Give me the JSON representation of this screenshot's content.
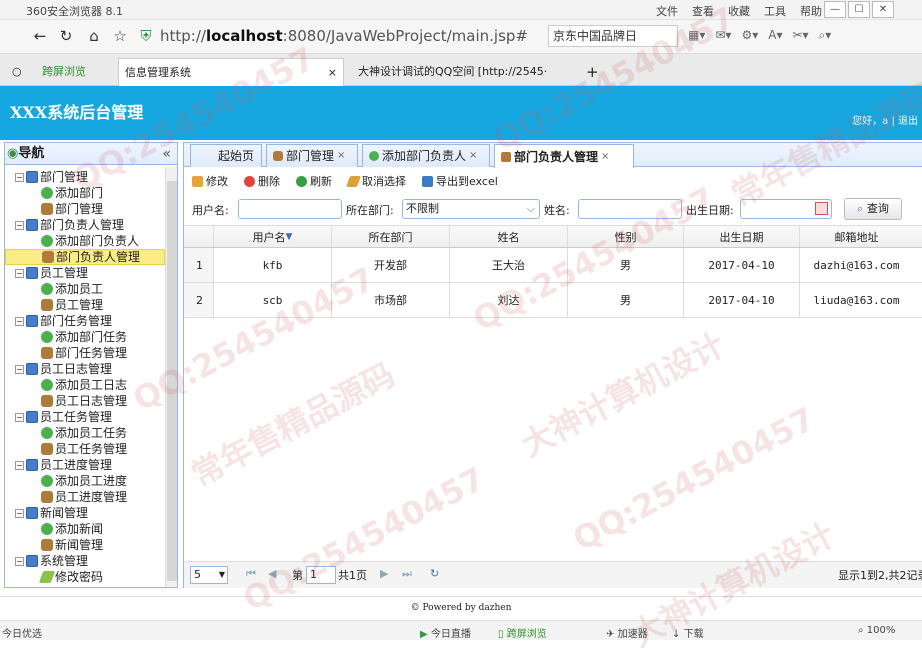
{
  "browser": {
    "title": "360安全浏览器 8.1",
    "menu": [
      "文件",
      "查看",
      "收藏",
      "工具",
      "帮助"
    ],
    "url_prefix": "http://",
    "url_host": "localhost",
    "url_rest": ":8080/JavaWebProject/main.jsp#",
    "search_placeholder": "京东中国品牌日",
    "tabs": [
      {
        "label": "跨屏浏览"
      },
      {
        "label": "信息管理系统"
      },
      {
        "label": "大神设计调试的QQ空间 [http://2545·"
      }
    ]
  },
  "app": {
    "title": "XXX系统后台管理",
    "user_text": "您好，a | 退出"
  },
  "nav": {
    "title": "导航",
    "collapse": "«",
    "tree": [
      {
        "label": "部门管理",
        "type": "folder"
      },
      {
        "label": "添加部门",
        "type": "add"
      },
      {
        "label": "部门管理",
        "type": "user"
      },
      {
        "label": "部门负责人管理",
        "type": "folder"
      },
      {
        "label": "添加部门负责人",
        "type": "add"
      },
      {
        "label": "部门负责人管理",
        "type": "user",
        "selected": true
      },
      {
        "label": "员工管理",
        "type": "folder"
      },
      {
        "label": "添加员工",
        "type": "add"
      },
      {
        "label": "员工管理",
        "type": "user"
      },
      {
        "label": "部门任务管理",
        "type": "folder"
      },
      {
        "label": "添加部门任务",
        "type": "add"
      },
      {
        "label": "部门任务管理",
        "type": "user"
      },
      {
        "label": "员工日志管理",
        "type": "folder"
      },
      {
        "label": "添加员工日志",
        "type": "add"
      },
      {
        "label": "员工日志管理",
        "type": "user"
      },
      {
        "label": "员工任务管理",
        "type": "folder"
      },
      {
        "label": "添加员工任务",
        "type": "add"
      },
      {
        "label": "员工任务管理",
        "type": "user"
      },
      {
        "label": "员工进度管理",
        "type": "folder"
      },
      {
        "label": "添加员工进度",
        "type": "add"
      },
      {
        "label": "员工进度管理",
        "type": "user"
      },
      {
        "label": "新闻管理",
        "type": "folder"
      },
      {
        "label": "添加新闻",
        "type": "add"
      },
      {
        "label": "新闻管理",
        "type": "user"
      },
      {
        "label": "系统管理",
        "type": "folder"
      },
      {
        "label": "修改密码",
        "type": "pen"
      }
    ]
  },
  "content_tabs": [
    {
      "label": "起始页",
      "closable": false
    },
    {
      "label": "部门管理",
      "closable": true
    },
    {
      "label": "添加部门负责人",
      "closable": true
    },
    {
      "label": "部门负责人管理",
      "closable": true,
      "active": true
    }
  ],
  "toolbar": {
    "edit": "修改",
    "delete": "删除",
    "refresh": "刷新",
    "unselect": "取消选择",
    "export": "导出到excel"
  },
  "filters": {
    "username_label": "用户名:",
    "dept_label": "所在部门:",
    "dept_value": "不限制",
    "name_label": "姓名:",
    "birth_label": "出生日期:",
    "search_button": "查询"
  },
  "table": {
    "columns": [
      "用户名",
      "所在部门",
      "姓名",
      "性别",
      "出生日期",
      "邮箱地址"
    ],
    "rows": [
      {
        "num": "1",
        "cells": [
          "kfb",
          "开发部",
          "王大治",
          "男",
          "2017-04-10",
          "dazhi@163.com"
        ]
      },
      {
        "num": "2",
        "cells": [
          "scb",
          "市场部",
          "刘达",
          "男",
          "2017-04-10",
          "liuda@163.com"
        ]
      }
    ]
  },
  "pager": {
    "page_size": "5",
    "page_prefix": "第",
    "page_value": "1",
    "page_total": "共1页",
    "summary": "显示1到2,共2记录"
  },
  "footer": {
    "powered": "© Powered by dazhen"
  },
  "statusbar": {
    "left": "今日优选",
    "items": [
      "今日直播",
      "跨屏浏览",
      "加速器",
      "下载"
    ],
    "zoom": "100%"
  },
  "watermarks": [
    "QQ:254540457",
    "大神计算机设计",
    "常年售精品源码"
  ]
}
